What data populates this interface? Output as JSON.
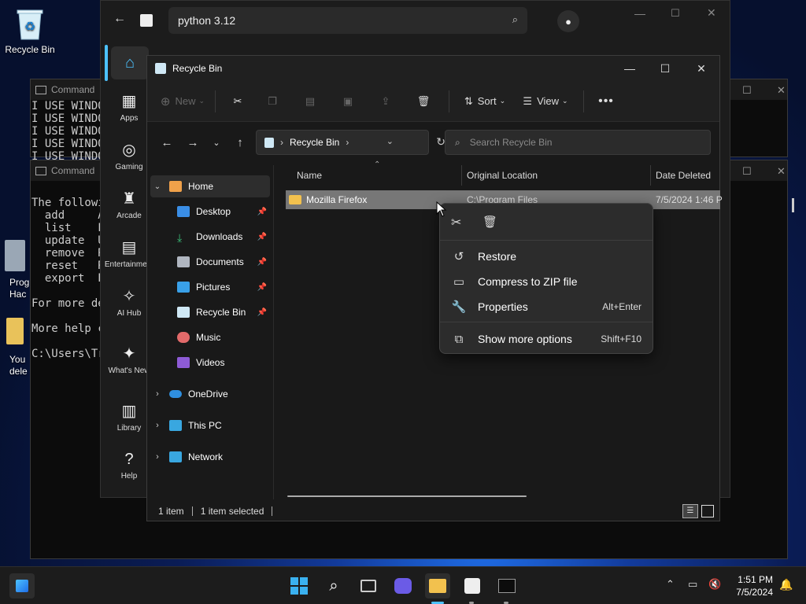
{
  "desktop": {
    "recycle_bin_label": "Recycle Bin",
    "icon2_label_partial": "Prog Hac",
    "icon3_label_partial": "You dele"
  },
  "terminal1": {
    "title": "Command",
    "lines": [
      "I USE WINDO",
      "I USE WINDO",
      "I USE WINDO",
      "I USE WINDO",
      "I USE WINDO"
    ]
  },
  "terminal2": {
    "title": "Command ",
    "lines": [
      "The followi",
      "  add     A",
      "  list    L",
      "  update  U",
      "  remove  R",
      "  reset   R",
      "  export  E",
      "",
      "For more de",
      "",
      "More help c",
      "",
      "C:\\Users\\Tr"
    ]
  },
  "xbox": {
    "search_text": "python 3.12",
    "nav": [
      {
        "label": "Apps",
        "icon": "apps-icon"
      },
      {
        "label": "Gaming",
        "icon": "gamepad-icon"
      },
      {
        "label": "Arcade",
        "icon": "arcade-icon"
      },
      {
        "label": "Entertainment",
        "icon": "clapper-icon"
      },
      {
        "label": "AI Hub",
        "icon": "sparkle-icon"
      },
      {
        "label": "What's New",
        "icon": "bell-icon"
      },
      {
        "label": "Library",
        "icon": "library-icon"
      },
      {
        "label": "Help",
        "icon": "help-icon"
      }
    ]
  },
  "explorer": {
    "title": "Recycle Bin",
    "toolbar": {
      "new_label": "New",
      "sort_label": "Sort",
      "view_label": "View"
    },
    "address": {
      "path": "Recycle Bin"
    },
    "search_placeholder": "Search Recycle Bin",
    "nav": {
      "home": "Home",
      "desktop": "Desktop",
      "downloads": "Downloads",
      "documents": "Documents",
      "pictures": "Pictures",
      "recycle_bin": "Recycle Bin",
      "music": "Music",
      "videos": "Videos",
      "onedrive": "OneDrive",
      "this_pc": "This PC",
      "network": "Network"
    },
    "columns": {
      "name": "Name",
      "original_location": "Original Location",
      "date_deleted": "Date Deleted"
    },
    "rows": [
      {
        "name": "Mozilla Firefox",
        "original_location": "C:\\Program Files",
        "date_deleted": "7/5/2024 1:46 P"
      }
    ],
    "status": {
      "items": "1 item",
      "selected": "1 item selected"
    }
  },
  "context_menu": {
    "items": [
      {
        "label": "Restore",
        "icon": "restore-icon",
        "shortcut": ""
      },
      {
        "label": "Compress to ZIP file",
        "icon": "zip-icon",
        "shortcut": ""
      },
      {
        "label": "Properties",
        "icon": "wrench-icon",
        "shortcut": "Alt+Enter"
      },
      {
        "label": "Show more options",
        "icon": "more-options-icon",
        "shortcut": "Shift+F10"
      }
    ]
  },
  "taskbar": {
    "time": "1:51 PM",
    "date": "7/5/2024"
  },
  "colors": {
    "accent": "#4cc2ff",
    "selected_row": "#777777"
  }
}
